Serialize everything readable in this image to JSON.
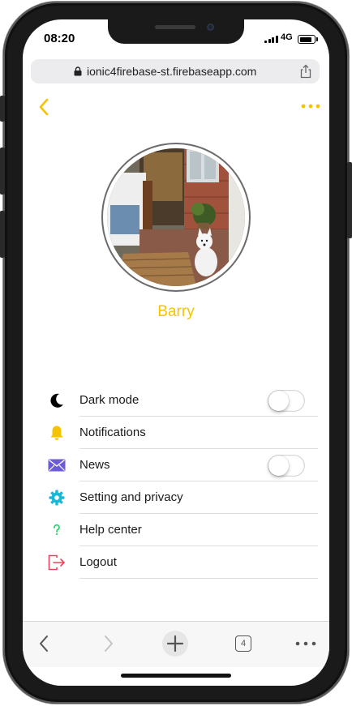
{
  "status_bar": {
    "time": "08:20",
    "network": "4G",
    "battery_level": 0.85
  },
  "browser": {
    "url": "ionic4firebase-st.firebaseapp.com",
    "open_tab_count": "4"
  },
  "profile": {
    "name": "Barry"
  },
  "menu": {
    "items": [
      {
        "label": "Dark mode",
        "icon": "moon-icon",
        "has_toggle": true,
        "toggled": false
      },
      {
        "label": "Notifications",
        "icon": "bell-icon",
        "has_toggle": false
      },
      {
        "label": "News",
        "icon": "mail-icon",
        "has_toggle": true,
        "toggled": false
      },
      {
        "label": "Setting and privacy",
        "icon": "gear-icon",
        "has_toggle": false
      },
      {
        "label": "Help center",
        "icon": "help-icon",
        "has_toggle": false
      },
      {
        "label": "Logout",
        "icon": "logout-icon",
        "has_toggle": false
      }
    ]
  },
  "colors": {
    "accent": "#f5c400",
    "bell": "#f5c400",
    "mail": "#6b5bd6",
    "gear": "#18b8d8",
    "help": "#2dd36f",
    "logout": "#eb445a"
  }
}
